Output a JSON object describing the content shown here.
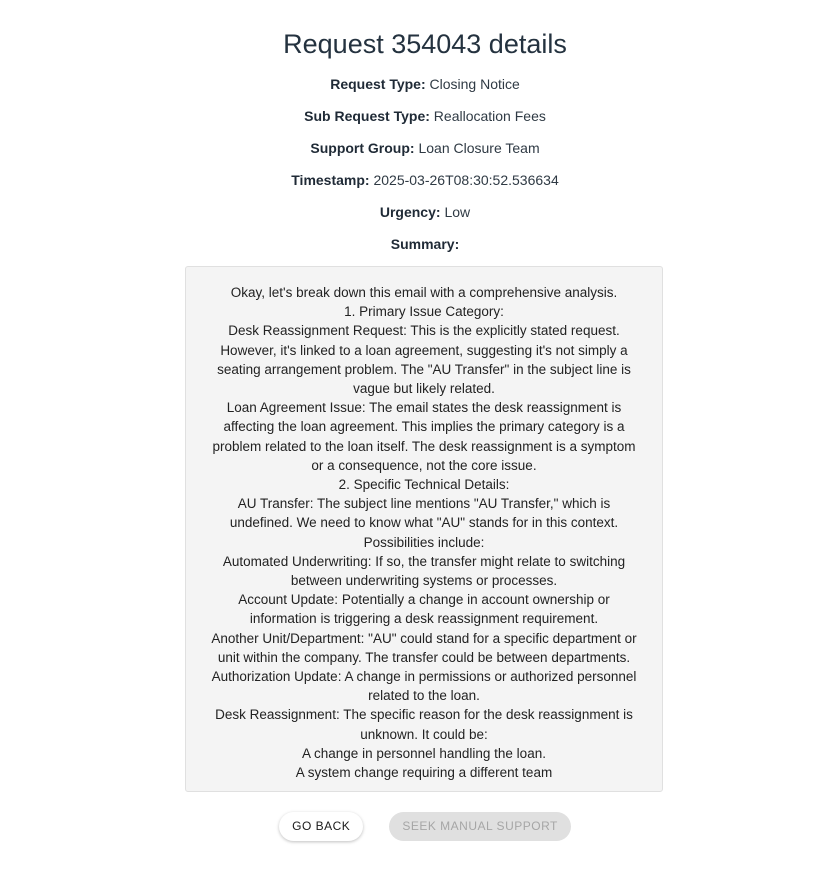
{
  "title": "Request 354043 details",
  "fields": {
    "request_type": {
      "label": "Request Type:",
      "value": "Closing Notice"
    },
    "sub_request_type": {
      "label": "Sub Request Type:",
      "value": "Reallocation Fees"
    },
    "support_group": {
      "label": "Support Group:",
      "value": "Loan Closure Team"
    },
    "timestamp": {
      "label": "Timestamp:",
      "value": "2025-03-26T08:30:52.536634"
    },
    "urgency": {
      "label": "Urgency:",
      "value": "Low"
    },
    "summary": {
      "label": "Summary:"
    }
  },
  "summary_lines": [
    "Okay, let's break down this email with a comprehensive analysis.",
    "1. Primary Issue Category:",
    "Desk Reassignment Request: This is the explicitly stated request.",
    "However, it's linked to a loan agreement, suggesting it's not simply a",
    "seating arrangement problem. The \"AU Transfer\" in the subject line is",
    "vague but likely related.",
    "Loan Agreement Issue: The email states the desk reassignment is",
    "affecting the loan agreement. This implies the primary category is a",
    "problem related to the loan itself. The desk reassignment is a symptom",
    "or a consequence, not the core issue.",
    "2. Specific Technical Details:",
    "AU Transfer: The subject line mentions \"AU Transfer,\" which is",
    "undefined. We need to know what \"AU\" stands for in this context.",
    "Possibilities include:",
    "Automated Underwriting: If so, the transfer might relate to switching",
    "between underwriting systems or processes.",
    "Account Update: Potentially a change in account ownership or",
    "information is triggering a desk reassignment requirement.",
    "Another Unit/Department: \"AU\" could stand for a specific department or",
    "unit within the company. The transfer could be between departments.",
    "Authorization Update: A change in permissions or authorized personnel",
    "related to the loan.",
    "Desk Reassignment: The specific reason for the desk reassignment is",
    "unknown. It could be:",
    "A change in personnel handling the loan.",
    "A system change requiring a different team"
  ],
  "buttons": {
    "go_back": "GO BACK",
    "seek_manual_support": "SEEK MANUAL SUPPORT"
  }
}
